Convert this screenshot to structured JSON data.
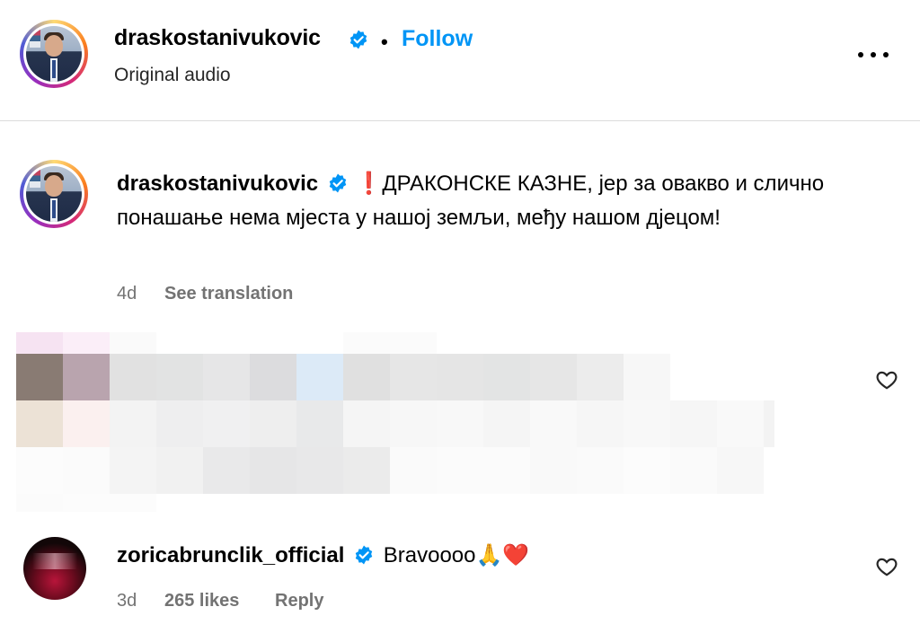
{
  "header": {
    "username": "draskostanivukovic",
    "separator": "•",
    "follow_label": "Follow",
    "subtitle": "Original audio"
  },
  "caption": {
    "username": "draskostanivukovic",
    "exclamation": "❗",
    "text": "ДРАКОНСКЕ КАЗНЕ, јер за овакво и слично понашање нема мјеста у нашој земљи, међу нашом дјецом!",
    "age": "4d",
    "translate_label": "See translation"
  },
  "comment": {
    "username": "zoricabrunclik_official",
    "text": "Bravoooo",
    "emojis": "🙏❤️",
    "age": "3d",
    "likes": "265 likes",
    "reply_label": "Reply"
  },
  "colors": {
    "accent": "#0095f6",
    "verified": "#0095f6",
    "muted": "#737373",
    "divider": "#dbdbdb"
  },
  "icons": {
    "more": "more-horizontal-icon",
    "verified": "verified-badge-icon",
    "like": "heart-outline-icon"
  }
}
